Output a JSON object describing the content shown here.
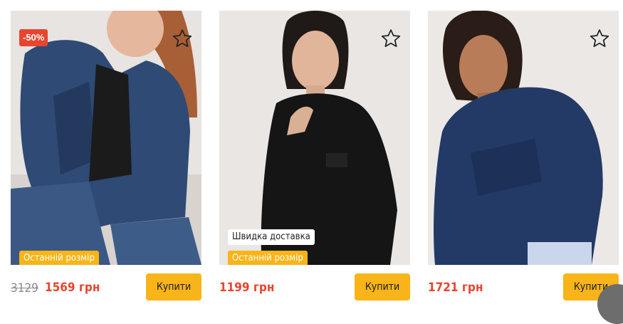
{
  "products": [
    {
      "sale_badge": "-50%",
      "tags": [
        "Останній розмір"
      ],
      "old_price": "3129",
      "price": "1569 грн",
      "buy_label": "Купити"
    },
    {
      "tags": [
        "Швидка доставка",
        "Останній розмір"
      ],
      "price": "1199 грн",
      "buy_label": "Купити"
    },
    {
      "tags": [],
      "price": "1721 грн",
      "buy_label": "Купити"
    }
  ],
  "icons": {
    "favorite": "star-outline-icon"
  },
  "colors": {
    "accent": "#f8b418",
    "sale": "#e8442e",
    "price": "#e8442e"
  }
}
